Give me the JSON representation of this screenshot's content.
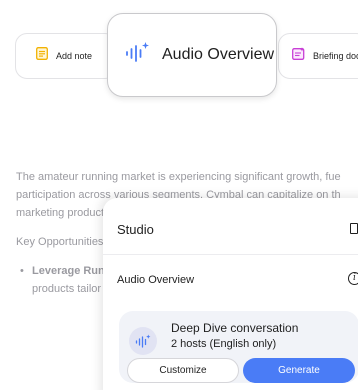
{
  "toolbar": {
    "add_note_label": "Add note",
    "audio_overview_label": "Audio Overview",
    "briefing_doc_label": "Briefing doc"
  },
  "background": {
    "line1": "The amateur running market is experiencing significant growth, fue",
    "line2": "participation across various segments. Cymbal can capitalize on th",
    "line3": "marketing product",
    "heading": "Key Opportunities",
    "bullet_bold": "Leverage Run",
    "bullet_rest": "products tailor"
  },
  "studio": {
    "title": "Studio",
    "section_label": "Audio Overview",
    "card": {
      "title": "Deep Dive conversation",
      "subtitle": "2 hosts (English only)",
      "customize_label": "Customize",
      "generate_label": "Generate"
    }
  },
  "colors": {
    "accent": "#4a7cf6",
    "note_icon": "#f2b203",
    "briefing_icon": "#c83fd6",
    "wave_icon": "#4a7cf6"
  }
}
